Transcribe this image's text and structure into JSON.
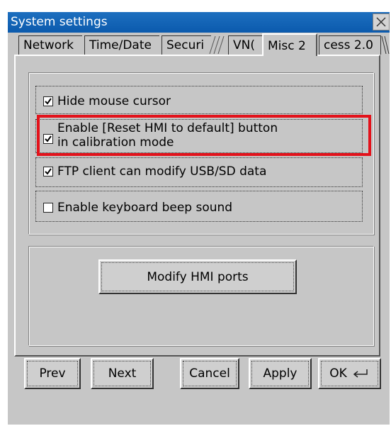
{
  "window": {
    "title": "System settings",
    "close_icon": "close-icon"
  },
  "tabs": [
    {
      "label": "Network",
      "active": false
    },
    {
      "label": "Time/Date",
      "active": false
    },
    {
      "label": "Securi",
      "active": false
    },
    {
      "label": "VN(",
      "active": false
    },
    {
      "label": "Misc 2",
      "active": true
    },
    {
      "label": "cess 2.0",
      "active": false
    }
  ],
  "options": [
    {
      "label": "Hide mouse cursor",
      "checked": true
    },
    {
      "label_line1": "Enable [Reset HMI to default] button",
      "label_line2": "in calibration mode",
      "checked": true
    },
    {
      "label": "FTP client can modify USB/SD data",
      "checked": true
    },
    {
      "label": "Enable keyboard beep sound",
      "checked": false
    }
  ],
  "modify_ports_label": "Modify HMI ports",
  "footer": {
    "prev": "Prev",
    "next": "Next",
    "cancel": "Cancel",
    "apply": "Apply",
    "ok": "OK",
    "ok_icon": "enter-icon"
  },
  "colors": {
    "titlebar": "#0b5aad",
    "highlight": "#e3121b",
    "background": "#c6c6c6"
  }
}
